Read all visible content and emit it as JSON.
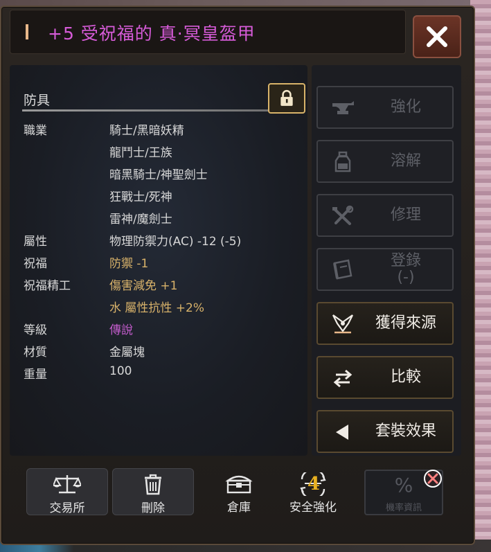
{
  "window": {
    "title": "+5 受祝福的 真·冥皇盔甲"
  },
  "category": "防具",
  "attributes": [
    {
      "label": "職業",
      "values": [
        "騎士/黑暗妖精",
        "龍鬥士/王族",
        "暗黑騎士/神聖劍士",
        "狂戰士/死神",
        "雷神/魔劍士"
      ]
    },
    {
      "label": "屬性",
      "values": [
        "物理防禦力(AC) -12 (-5)"
      ]
    },
    {
      "label": "祝福",
      "values": [
        "防禦 -1"
      ]
    },
    {
      "label": "祝福精工",
      "values": [
        "傷害減免 +1",
        "水 屬性抗性 +2%"
      ]
    },
    {
      "label": "等級",
      "values": [
        "傳說"
      ]
    },
    {
      "label": "材質",
      "values": [
        "金屬塊"
      ]
    },
    {
      "label": "重量",
      "values": [
        "100"
      ]
    }
  ],
  "side_buttons": [
    {
      "label": "強化",
      "icon": "anvil-icon",
      "enabled": false
    },
    {
      "label": "溶解",
      "icon": "flask-icon",
      "enabled": false
    },
    {
      "label": "修理",
      "icon": "tools-icon",
      "enabled": false
    },
    {
      "label": "登錄\n(-)",
      "icon": "book-icon",
      "enabled": false
    },
    {
      "label": "獲得來源",
      "icon": "source-icon",
      "enabled": true
    },
    {
      "label": "比較",
      "icon": "swap-arrows-icon",
      "enabled": true
    },
    {
      "label": "套裝效果",
      "icon": "play-left-icon",
      "enabled": true
    }
  ],
  "bottom_buttons": [
    {
      "label": "交易所",
      "icon": "scales-icon"
    },
    {
      "label": "刪除",
      "icon": "trash-icon"
    },
    {
      "label": "倉庫",
      "icon": "chest-icon"
    },
    {
      "label": "安全強化",
      "icon": "safe-enhance-icon",
      "badge": "4"
    },
    {
      "label": "機率資訊",
      "icon": "percent-icon"
    }
  ],
  "colors": {
    "title": "#d65bd8",
    "gold_value": "#d8b26a",
    "legend_purple": "#c35ccc",
    "disabled_text": "#5d5f66"
  }
}
